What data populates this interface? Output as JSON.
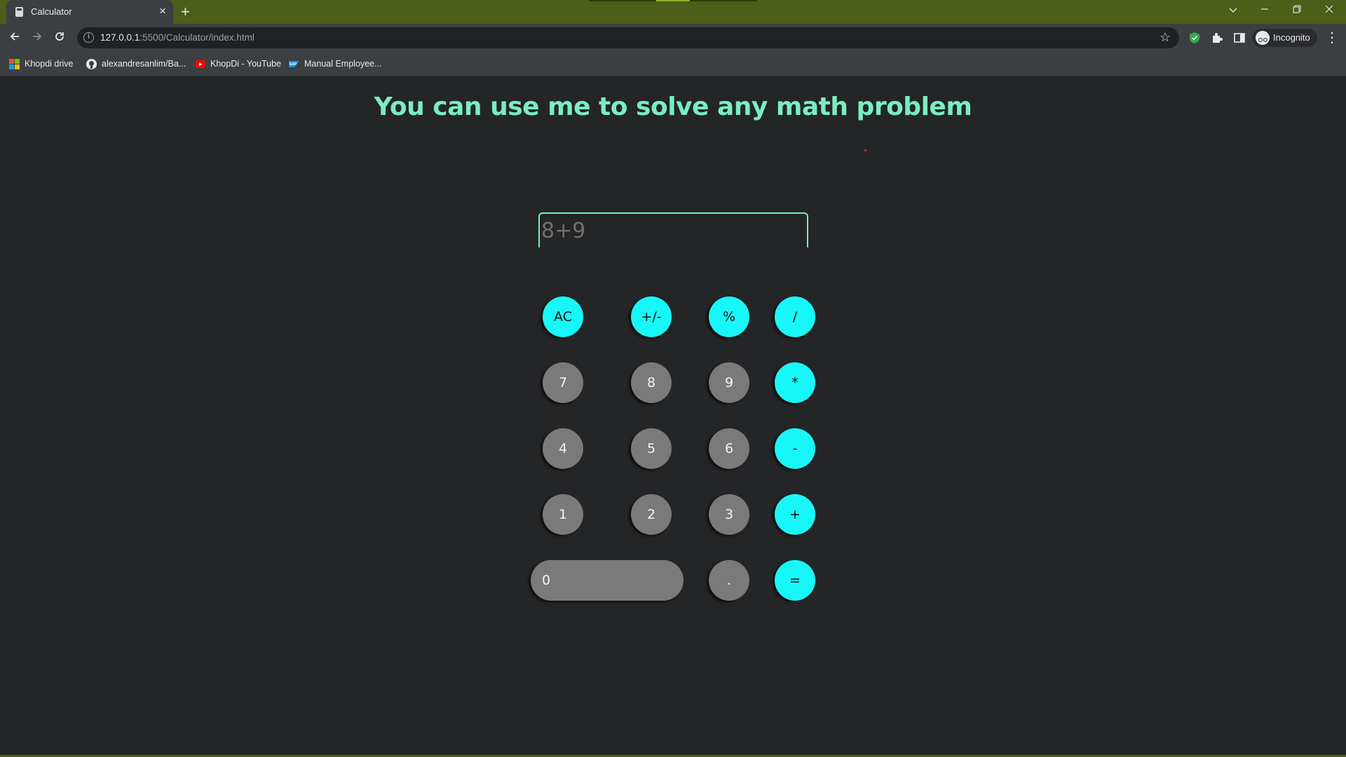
{
  "browser": {
    "tab_title": "Calculator",
    "tab_close": "×",
    "new_tab": "+",
    "url_host": "127.0.0.1",
    "url_rest": ":5500/Calculator/index.html",
    "profile_label": "Incognito",
    "accent_color": "#4c5e17",
    "bookmarks": [
      {
        "label": "Khopdi drive",
        "icon": "windows-logo-icon"
      },
      {
        "label": "alexandresanlim/Ba...",
        "icon": "github-icon"
      },
      {
        "label": "KhopDi - YouTube",
        "icon": "youtube-icon"
      },
      {
        "label": "Manual Employee...",
        "icon": "sap-icon"
      }
    ]
  },
  "page": {
    "heading": "You can use me to solve any math problem",
    "heading_color": "#7aeec0",
    "display_placeholder": "8+9",
    "display_value": "",
    "operator_color": "#18f7f7",
    "number_color": "#7a7a7a",
    "keys": {
      "ac": "AC",
      "sign": "+/-",
      "percent": "%",
      "divide": "/",
      "seven": "7",
      "eight": "8",
      "nine": "9",
      "multiply": "*",
      "four": "4",
      "five": "5",
      "six": "6",
      "minus": "-",
      "one": "1",
      "two": "2",
      "three": "3",
      "plus": "+",
      "zero": "0",
      "decimal": ".",
      "equals": "="
    }
  }
}
